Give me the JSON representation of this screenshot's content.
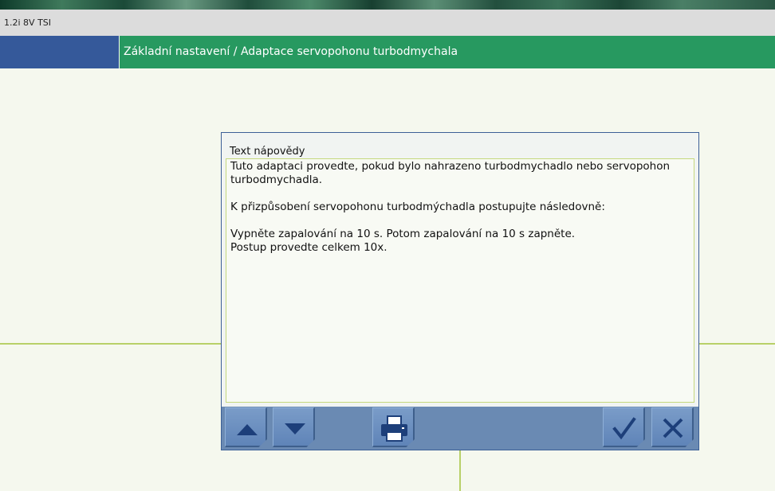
{
  "vehicle": {
    "label": "1.2i 8V TSI"
  },
  "header": {
    "title": "Základní nastavení / Adaptace servopohonu turbodmychala"
  },
  "dialog": {
    "title": "Text nápovědy",
    "body": "Tuto adaptaci provedte, pokud bylo nahrazeno turbodmychadlo nebo servopohon turbodmychadla.\n\nK přizpůsobení servopohonu turbodmýchadla postupujte následovně:\n\nVypněte zapalování na 10 s. Potom zapalování na 10 s zapněte.\nPostup provedte celkem 10x."
  },
  "toolbar": {
    "buttons": [
      {
        "icon": "arrow-up-icon"
      },
      {
        "icon": "arrow-down-icon"
      },
      {
        "icon": "printer-icon"
      },
      {
        "icon": "checkmark-icon"
      },
      {
        "icon": "close-icon"
      }
    ]
  },
  "colors": {
    "header_green": "#279960",
    "header_blue": "#35599a",
    "toolbar_blue": "#6a8ab3",
    "accent_line": "#b8d068",
    "icon_blue": "#1d3f7a"
  }
}
